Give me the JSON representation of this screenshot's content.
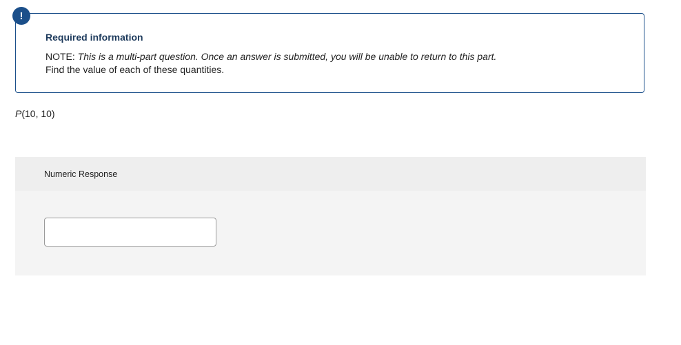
{
  "alert": {
    "icon": "exclamation-icon",
    "symbol": "!",
    "color": "#1b4f8a"
  },
  "info_box": {
    "title": "Required information",
    "note_prefix": "NOTE:",
    "note_text": "This is a multi-part question. Once an answer is submitted, you will be unable to return to this part.",
    "instruction": "Find the value of each of these quantities."
  },
  "question": {
    "func": "P",
    "args": "(10, 10)"
  },
  "response": {
    "label": "Numeric Response",
    "value": "",
    "placeholder": ""
  }
}
